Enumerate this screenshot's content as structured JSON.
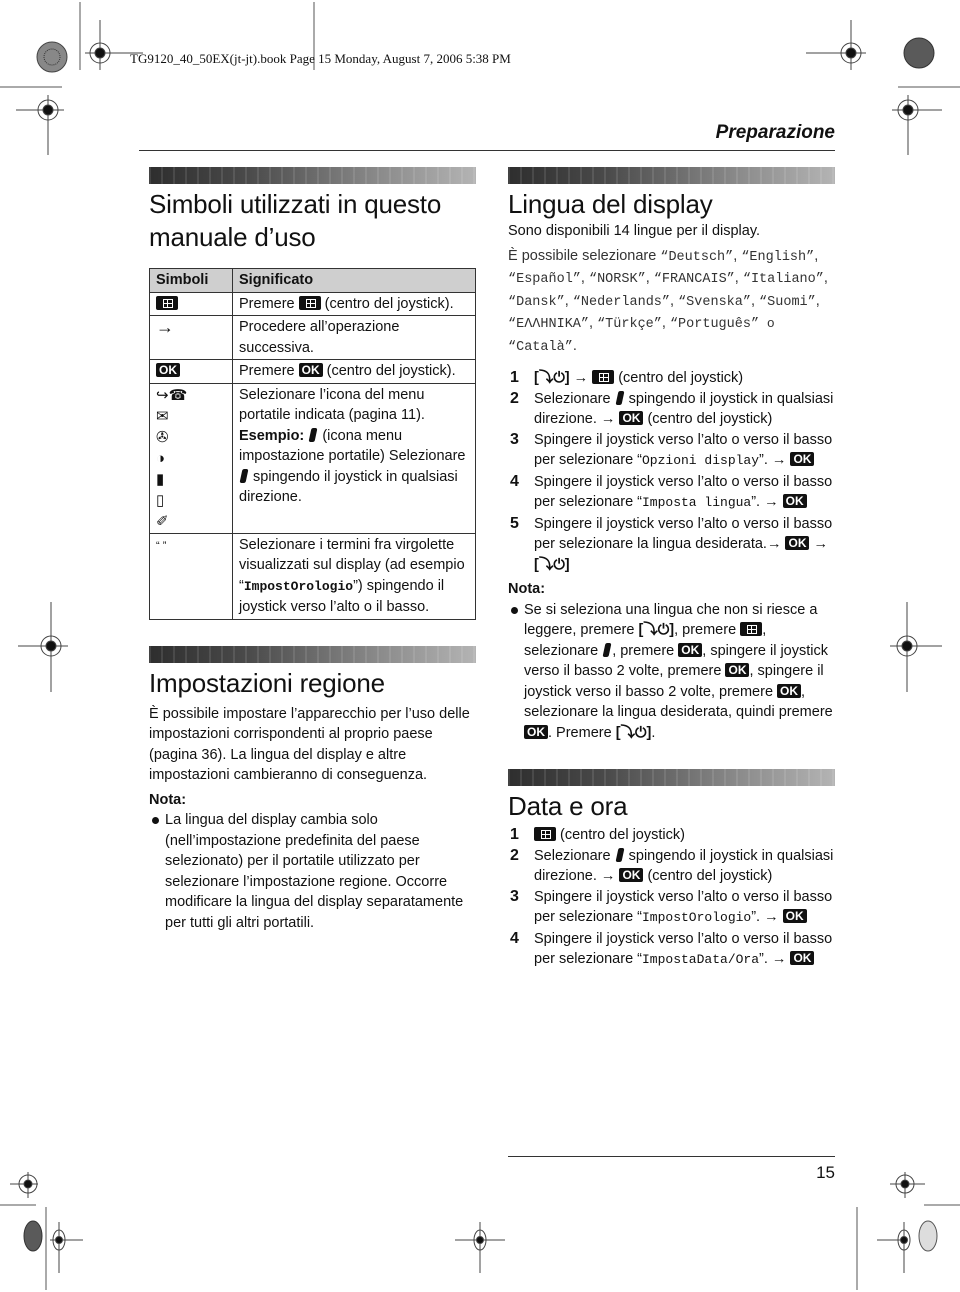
{
  "runhead": "TG9120_40_50EX(jt-jt).book  Page 15  Monday, August 7, 2006  5:38 PM",
  "section_label": "Preparazione",
  "page_number": "15",
  "symbols_section": {
    "title_line1": "Simboli utilizzati in questo",
    "title_line2": "manuale d’uso",
    "col_symbols": "Simboli",
    "col_meaning": "Significato",
    "rows": [
      {
        "symbol": "menu-key-icon",
        "pre": "Premere ",
        "post": " (centro del joystick)."
      },
      {
        "symbol": "→",
        "text": "Procedere all’operazione successiva."
      },
      {
        "symbol": "OK",
        "pre": "Premere ",
        "key": "OK",
        "post": " (centro del joystick)."
      },
      {
        "symbols": [
          "↪☎",
          "✉",
          "✇",
          "◑",
          "▮",
          "▯",
          "✐"
        ],
        "line1": "Selezionare l’icona del menu portatile indicata (pagina 11).",
        "example_label": "Esempio: ",
        "example_text": " (icona menu impostazione portatile)",
        "select_pre": "Selezionare ",
        "select_post": " spingendo il joystick in qualsiasi direzione."
      },
      {
        "symbol": "“ ”",
        "pre": "Selezionare i termini fra virgolette visualizzati sul display (ad esempio “",
        "mono": "ImpostOrologio",
        "post": "”) spingendo il joystick verso l’alto o il basso."
      }
    ]
  },
  "region_section": {
    "title": "Impostazioni regione",
    "body": "È possibile impostare l’apparecchio per l’uso delle impostazioni corrispondenti al proprio paese (pagina 36). La lingua del display e altre impostazioni cambieranno di conseguenza.",
    "note_label": "Nota:",
    "note": "La lingua del display cambia solo (nell’impostazione predefinita del paese selezionato) per il portatile utilizzato per selezionare l’impostazione regione. Occorre modificare la lingua del display separatamente per tutti gli altri portatili."
  },
  "language_section": {
    "title": "Lingua del display",
    "subtitle": "Sono disponibili 14 lingue per il display.",
    "intro": "È possibile selezionare ",
    "languages": [
      "Deutsch",
      "English",
      "Español",
      "NORSK",
      "FRANCAIS",
      "Italiano",
      "Dansk",
      "Nederlands",
      "Svenska",
      "Suomi",
      "ΕΛΛΗΝΙΚΑ",
      "Türkçe",
      "Português",
      "Català"
    ],
    "or_word": "o",
    "steps": [
      {
        "num": "1",
        "key_off": "[⤵⏻]",
        "arrow": "→",
        "post": " (centro del joystick)"
      },
      {
        "num": "2",
        "pre": "Selezionare ",
        "mid": " spingendo il joystick in qualsiasi direzione. → ",
        "key": "OK",
        "post": " (centro del joystick)"
      },
      {
        "num": "3",
        "pre": "Spingere il joystick verso l’alto o verso il basso per selezionare “",
        "mono": "Opzioni display",
        "post": "”. → ",
        "key": "OK"
      },
      {
        "num": "4",
        "pre": "Spingere il joystick verso l’alto o verso il basso per selezionare “",
        "mono": "Imposta lingua",
        "post": "”. → ",
        "key": "OK"
      },
      {
        "num": "5",
        "pre": "Spingere il joystick verso l’alto o verso il basso per selezionare la lingua desiderata.→ ",
        "key": "OK",
        "post": " → ",
        "key_off": "[⤵⏻]"
      }
    ],
    "note_label": "Nota:",
    "note_parts": {
      "p1": "Se si seleziona una lingua che non si riesce a leggere, premere ",
      "off": "[⤵⏻]",
      "p2": ", premere ",
      "p3": ", selezionare ",
      "p4": ", premere ",
      "p5": ", spingere il joystick verso il basso 2 volte, premere ",
      "p6": ", spingere il joystick verso il basso 2 volte, premere ",
      "p7": ", selezionare la lingua desiderata, quindi premere ",
      "p8": ". Premere ",
      "p9": ".",
      "ok": "OK"
    }
  },
  "datetime_section": {
    "title": "Data e ora",
    "steps": [
      {
        "num": "1",
        "post": " (centro del joystick)"
      },
      {
        "num": "2",
        "pre": "Selezionare ",
        "mid": " spingendo il joystick in qualsiasi direzione. → ",
        "key": "OK",
        "post": " (centro del joystick)"
      },
      {
        "num": "3",
        "pre": "Spingere il joystick verso l’alto o verso il basso per selezionare “",
        "mono": "ImpostOrologio",
        "post": "”. → ",
        "key": "OK"
      },
      {
        "num": "4",
        "pre": "Spingere il joystick verso l’alto o verso il basso per selezionare “",
        "mono": "ImpostaData/Ora",
        "post": "”. → ",
        "key": "OK"
      }
    ]
  }
}
